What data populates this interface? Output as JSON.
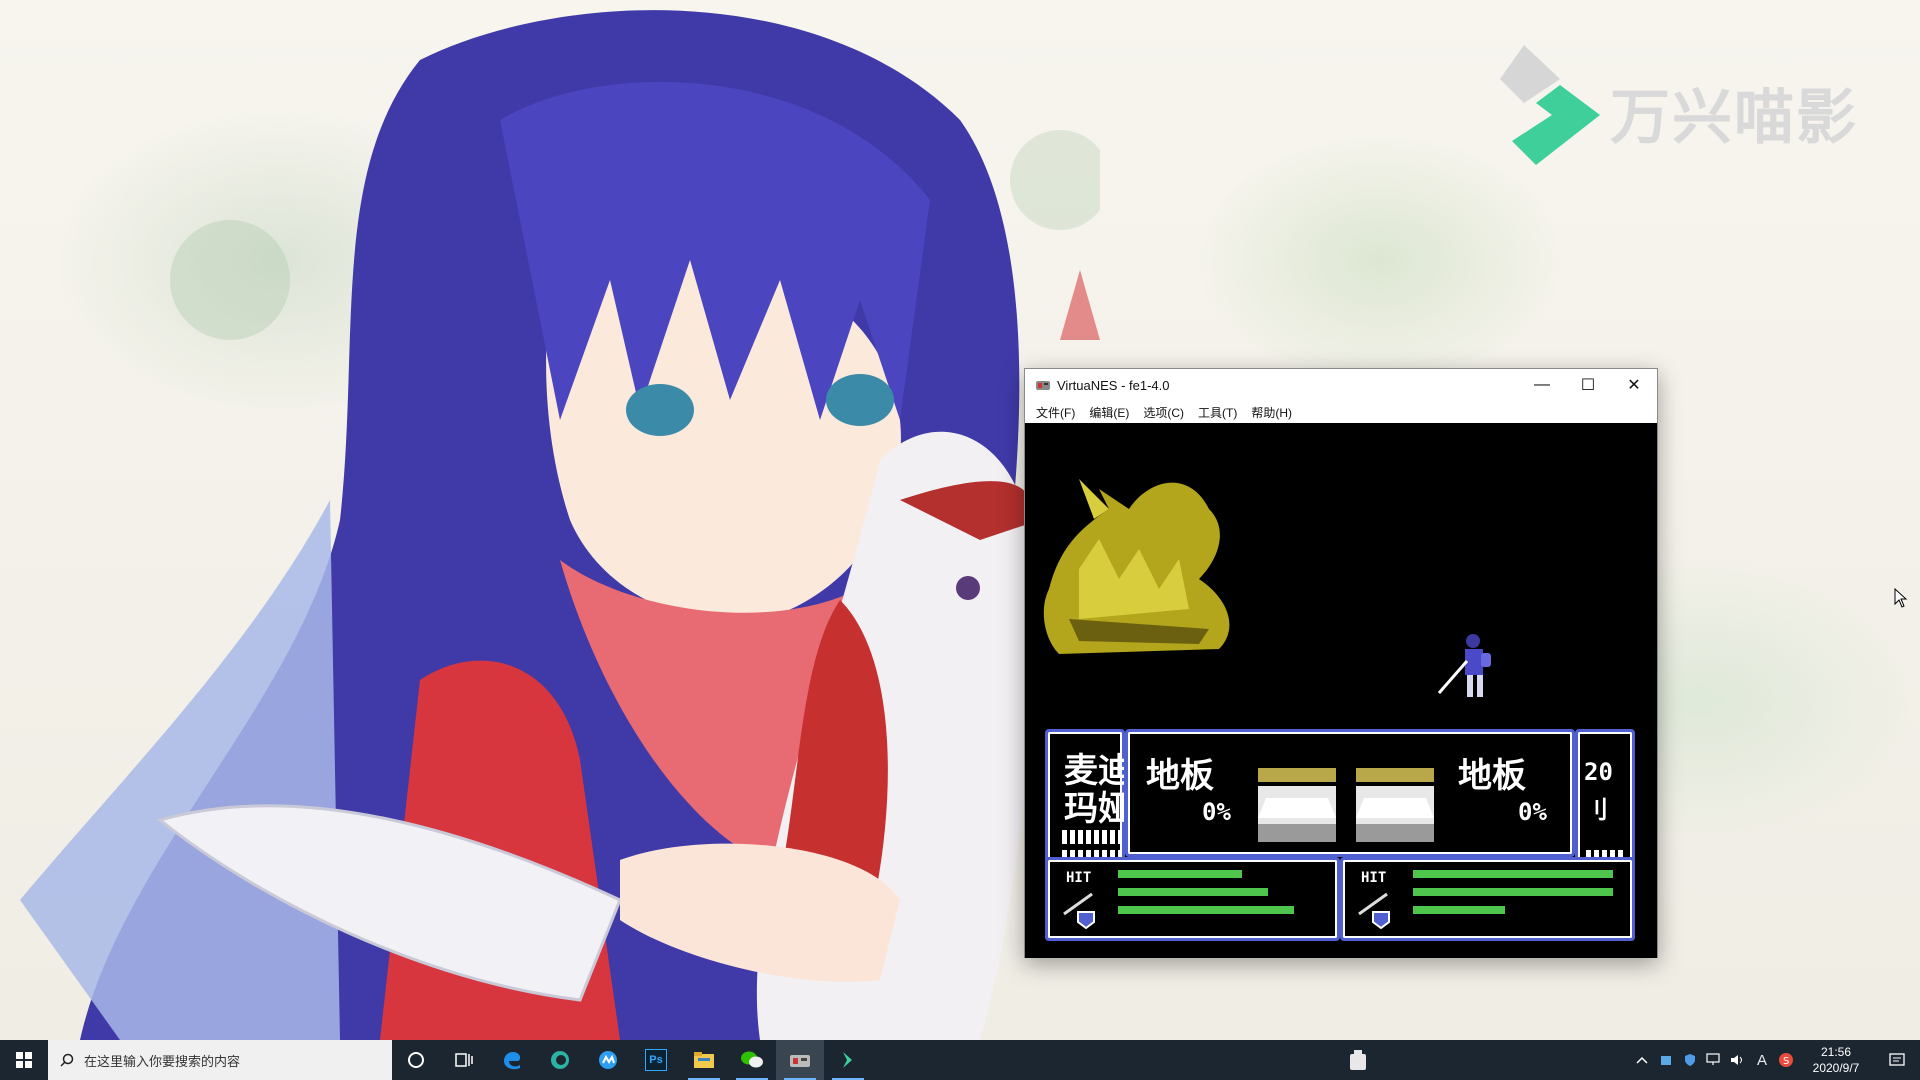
{
  "watermark": {
    "text": "万兴喵影"
  },
  "window": {
    "title": "VirtuaNES - fe1-4.0",
    "menu": [
      "文件(F)",
      "编辑(E)",
      "选项(C)",
      "工具(T)",
      "帮助(H)"
    ],
    "buttons": {
      "minimize": "—",
      "maximize": "☐",
      "close": "✕"
    }
  },
  "game": {
    "left_unit_name": "麦迪\n玛娅",
    "terrain_left": "地板",
    "terrain_right": "地板",
    "terrain_left_pct": "0%",
    "terrain_right_pct": "0%",
    "right_level": "20",
    "right_level_char": "刂",
    "hit_left": "HIT",
    "hit_right": "HIT",
    "left_bars": [
      0.62,
      0.75,
      0.88
    ],
    "right_bars": [
      1.0,
      1.0,
      0.46
    ]
  },
  "taskbar": {
    "search_placeholder": "在这里输入你要搜索的内容",
    "apps": [
      "cortana-icon",
      "task-view-icon",
      "edge-legacy-icon",
      "edge-icon",
      "maxthon-icon",
      "photoshop-icon",
      "file-explorer-icon",
      "wechat-icon",
      "virtuanes-icon",
      "filmora-icon"
    ],
    "ps_label": "Ps",
    "clock_time": "21:56",
    "clock_date": "2020/9/7",
    "ime_label": "A"
  }
}
